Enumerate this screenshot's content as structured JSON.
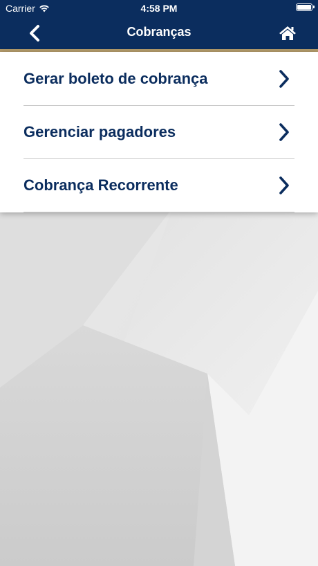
{
  "status_bar": {
    "carrier": "Carrier",
    "time": "4:58 PM",
    "wifi_icon": "wifi-icon",
    "battery_icon": "battery-icon"
  },
  "nav": {
    "title": "Cobranças",
    "back_icon": "chevron-left-icon",
    "home_icon": "home-icon"
  },
  "menu": {
    "items": [
      {
        "label": "Gerar boleto de cobrança",
        "icon": "chevron-right-icon"
      },
      {
        "label": "Gerenciar pagadores",
        "icon": "chevron-right-icon"
      },
      {
        "label": "Cobrança Recorrente",
        "icon": "chevron-right-icon"
      }
    ]
  },
  "colors": {
    "brand_navy": "#0b2d5e",
    "accent_gold": "#b39a6a",
    "divider": "#c8c8c8"
  }
}
